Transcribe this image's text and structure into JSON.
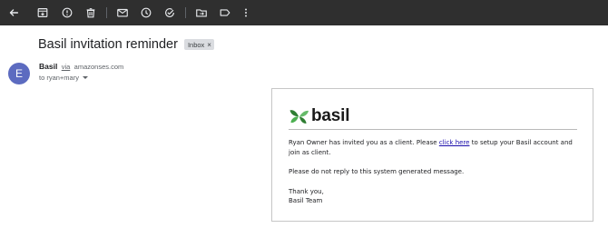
{
  "toolbar": {
    "icons": [
      "back-arrow-icon",
      "archive-icon",
      "report-spam-icon",
      "delete-icon",
      "mark-unread-icon",
      "snooze-icon",
      "add-to-tasks-icon",
      "move-to-icon",
      "labels-icon",
      "more-vert-icon"
    ]
  },
  "email": {
    "subject": "Basil invitation reminder",
    "label": "Inbox",
    "label_remove": "×",
    "avatar_letter": "E",
    "sender_name": "Basil",
    "via": "via",
    "sender_domain": "amazonses.com",
    "recipients": "to ryan+mary"
  },
  "message": {
    "brand": "basil",
    "line1_before": "Ryan Owner has invited you as a client. Please ",
    "link_text": "click here",
    "line1_after": " to setup your Basil account and join as client.",
    "line2": "Please do not reply to this system generated message.",
    "signoff": "Thank you,",
    "signature": "Basil Team"
  }
}
